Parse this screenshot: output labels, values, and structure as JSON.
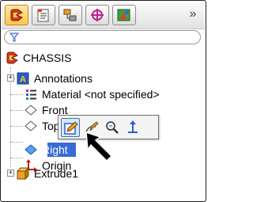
{
  "tabs": [
    {
      "icon": "featuremanager-tree-icon",
      "active": true
    },
    {
      "icon": "propertymanager-icon",
      "active": false
    },
    {
      "icon": "configurationmanager-icon",
      "active": false
    },
    {
      "icon": "dimxpert-manager-icon",
      "active": false
    },
    {
      "icon": "display-manager-icon",
      "active": false
    }
  ],
  "overflow_label": "»",
  "filter_icon": "filter-icon",
  "tree": {
    "root": {
      "label": "CHASSIS",
      "icon": "part-icon"
    },
    "items": [
      {
        "label": "Annotations",
        "icon": "annotations-icon",
        "expander": "+"
      },
      {
        "label": "Material <not specified>",
        "icon": "material-icon"
      },
      {
        "label": "Front",
        "icon": "plane-icon"
      },
      {
        "label": "Top",
        "icon": "plane-icon"
      },
      {
        "label": "Right",
        "icon": "plane-icon",
        "selected": true
      },
      {
        "label": "Origin",
        "icon": "origin-icon"
      },
      {
        "label": "Extrude1",
        "icon": "extrude-icon",
        "expander": "+"
      }
    ]
  },
  "context_toolbar": {
    "buttons": [
      {
        "icon": "edit-sketch-icon",
        "hot": true
      },
      {
        "icon": "sketch-icon"
      },
      {
        "icon": "zoom-to-selection-icon"
      },
      {
        "icon": "normal-to-icon"
      }
    ]
  },
  "colors": {
    "selection": "#3a6ad4",
    "tab_active": "#ffc64a",
    "toolbar_hot": "#3c6fb5"
  }
}
